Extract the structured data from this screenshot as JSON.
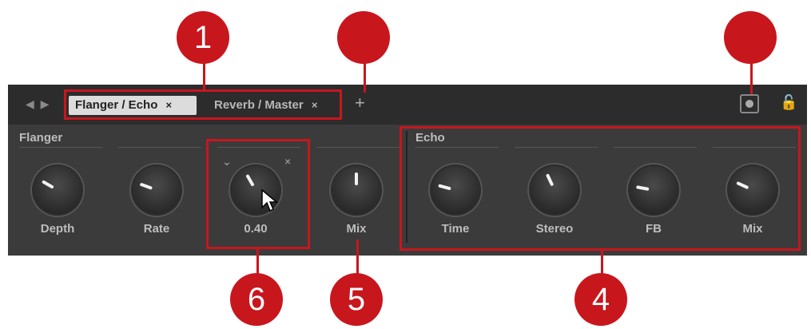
{
  "tabs": [
    {
      "label": "Flanger / Echo",
      "close": "×",
      "active": true
    },
    {
      "label": "Reverb / Master",
      "close": "×",
      "active": false
    }
  ],
  "tab_add": "+",
  "nav_arrows": "◀ ▶",
  "sections": {
    "flanger": {
      "title": "Flanger",
      "knobs": [
        {
          "label": "Depth"
        },
        {
          "label": "Rate"
        },
        {
          "label": "0.40"
        },
        {
          "label": "Mix"
        }
      ]
    },
    "echo": {
      "title": "Echo",
      "knobs": [
        {
          "label": "Time"
        },
        {
          "label": "Stereo"
        },
        {
          "label": "FB"
        },
        {
          "label": "Mix"
        }
      ]
    }
  },
  "knob_controls": {
    "chevron": "⌄",
    "close": "×"
  },
  "callouts": {
    "c1": "1",
    "c4": "4",
    "c5": "5",
    "c6": "6"
  },
  "colors": {
    "accent_red": "#c8161d",
    "panel": "#3b3b3b",
    "tabbar": "#2c2c2c"
  }
}
